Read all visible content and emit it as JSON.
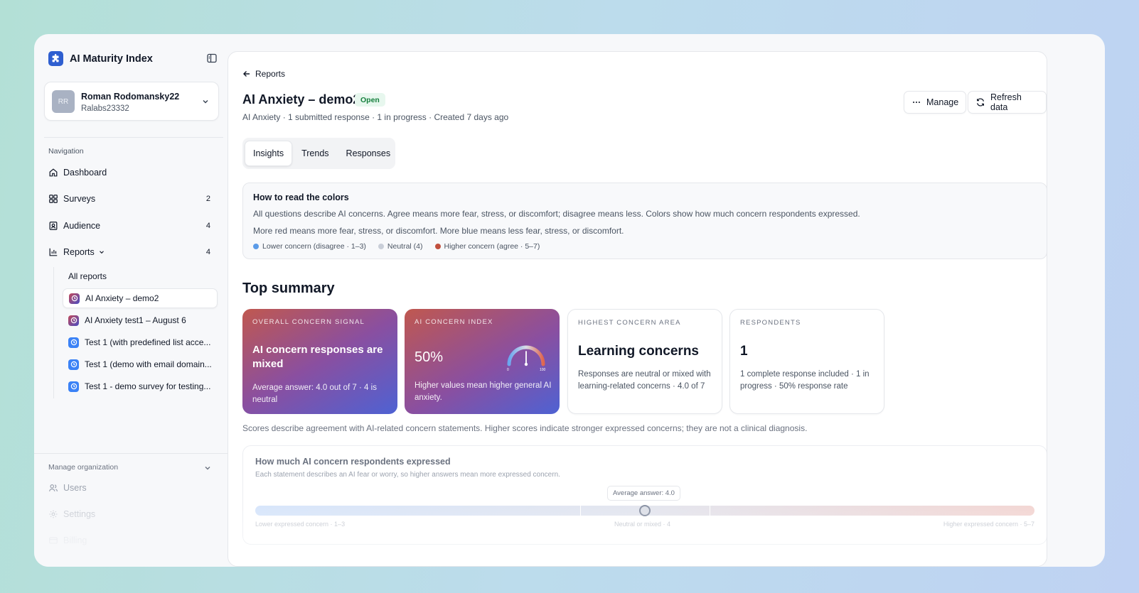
{
  "app": {
    "name": "AI Maturity Index"
  },
  "user": {
    "initials": "RR",
    "name": "Roman Rodomansky22",
    "org": "Ralabs23332"
  },
  "sidebar": {
    "nav_heading": "Navigation",
    "items": [
      {
        "label": "Dashboard",
        "count": ""
      },
      {
        "label": "Surveys",
        "count": "2"
      },
      {
        "label": "Audience",
        "count": "4"
      },
      {
        "label": "Reports",
        "count": "4"
      }
    ],
    "all_reports": "All reports",
    "reports": [
      {
        "label": "AI Anxiety – demo2"
      },
      {
        "label": "AI Anxiety test1 – August 6"
      },
      {
        "label": "Test 1 (with predefined list acce..."
      },
      {
        "label": "Test 1 (demo with email domain..."
      },
      {
        "label": "Test 1 - demo survey for testing..."
      }
    ],
    "manage_heading": "Manage organization",
    "manage_items": [
      {
        "label": "Users"
      },
      {
        "label": "Settings"
      },
      {
        "label": "Billing"
      }
    ]
  },
  "header": {
    "back_label": "Reports",
    "title": "AI Anxiety – demo2",
    "status": "Open",
    "meta": "AI Anxiety · 1 submitted response · 1 in progress · Created 7 days ago",
    "manage_label": "Manage",
    "refresh_label": "Refresh data"
  },
  "tabs": [
    {
      "label": "Insights"
    },
    {
      "label": "Trends"
    },
    {
      "label": "Responses"
    }
  ],
  "colors_card": {
    "title": "How to read the colors",
    "line1": "All questions describe AI concerns. Agree means more fear, stress, or discomfort; disagree means less. Colors show how much concern respondents expressed.",
    "line2": "More red means more fear, stress, or discomfort. More blue means less fear, stress, or discomfort.",
    "legend": [
      {
        "label": "Lower concern (disagree · 1–3)",
        "color": "#5b9be8"
      },
      {
        "label": "Neutral (4)",
        "color": "#c9ced8"
      },
      {
        "label": "Higher concern (agree · 5–7)",
        "color": "#c1503e"
      }
    ]
  },
  "summary": {
    "title": "Top summary",
    "cards": [
      {
        "kicker": "Overall concern signal",
        "headline": "AI concern responses are mixed",
        "sub": "Average answer: 4.0 out of 7 · 4 is neutral"
      },
      {
        "kicker": "AI concern index",
        "value": "50%",
        "sub": "Higher values mean higher general AI anxiety.",
        "gauge_min": "0",
        "gauge_max": "100",
        "gauge_value": 50
      },
      {
        "kicker": "Highest concern area",
        "headline": "Learning concerns",
        "sub": "Responses are neutral or mixed with learning-related concerns · 4.0 of 7"
      },
      {
        "kicker": "Respondents",
        "value": "1",
        "sub": "1 complete response included · 1 in progress · 50% response rate"
      }
    ],
    "disclaimer": "Scores describe agreement with AI-related concern statements. Higher scores indicate stronger expressed concerns; they are not a clinical diagnosis."
  },
  "concern": {
    "title": "How much AI concern respondents expressed",
    "sub": "Each statement describes an AI fear or worry, so higher answers mean more expressed concern.",
    "average_tip": "Average answer: 4.0",
    "average_value": 4.0,
    "scale_min": 1,
    "scale_max": 7,
    "labels": {
      "low": "Lower expressed concern · 1–3",
      "neutral": "Neutral or mixed · 4",
      "high": "Higher expressed concern · 5–7"
    }
  }
}
